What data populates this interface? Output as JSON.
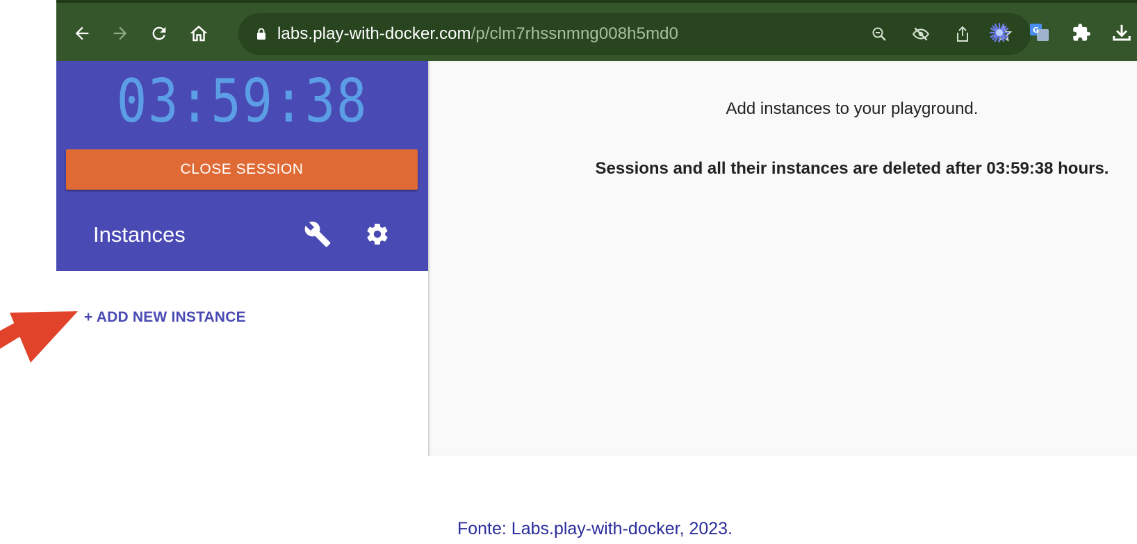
{
  "browser": {
    "url_host": "labs.play-with-docker.com",
    "url_path": "/p/clm7rhssnmng008h5md0"
  },
  "colors": {
    "chrome_bg": "#35552a",
    "omnibox_bg": "#284520",
    "sidebar_accent": "#4a4ab4",
    "timer": "#5b9ee6",
    "close_button": "#e06a35",
    "arrow": "#e0432a",
    "caption": "#2a2e9a"
  },
  "sidebar": {
    "timer": "03:59:38",
    "close_session_label": "CLOSE SESSION",
    "instances_title": "Instances",
    "add_instance_label": "+ ADD NEW INSTANCE",
    "icons": [
      "wrench-icon",
      "gear-icon"
    ]
  },
  "main": {
    "message": "Add instances to your playground.",
    "expiry_message": "Sessions and all their instances are deleted after 03:59:38 hours."
  },
  "caption": "Fonte: Labs.play-with-docker, 2023."
}
